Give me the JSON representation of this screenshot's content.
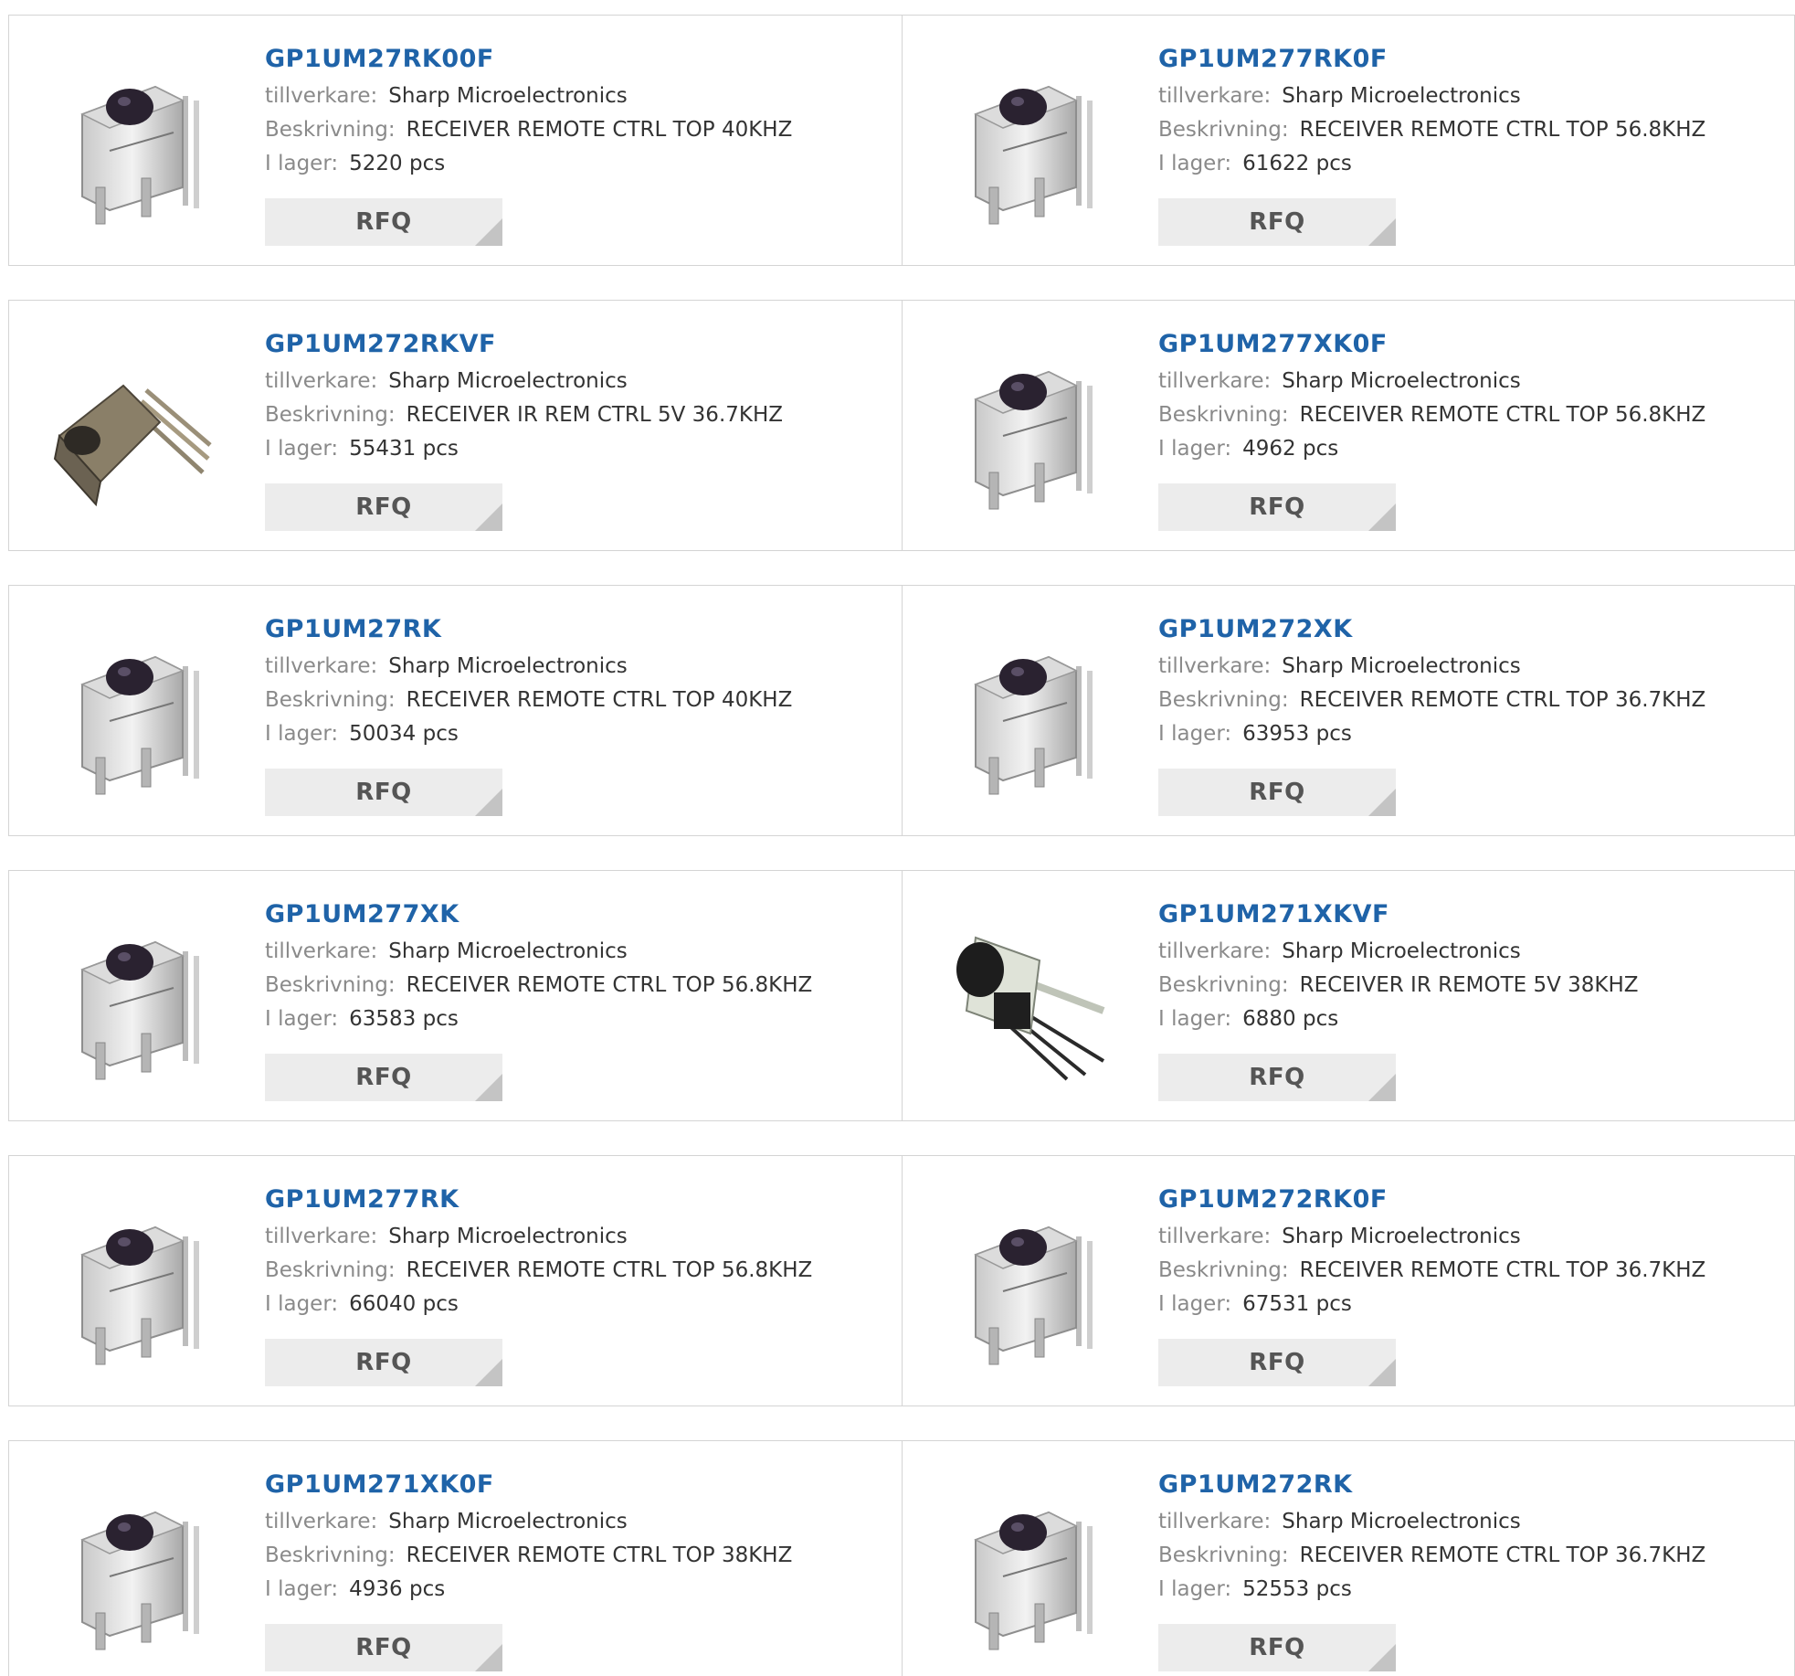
{
  "labels": {
    "manufacturer": "tillverkare:",
    "description": "Beskrivning:",
    "stock": "I lager:",
    "rfq": "RFQ"
  },
  "products": [
    {
      "part": "GP1UM27RK00F",
      "manufacturer": "Sharp Microelectronics",
      "description": "RECEIVER REMOTE CTRL TOP 40KHZ",
      "stock": "5220 pcs",
      "image": "ir-receiver-upright"
    },
    {
      "part": "GP1UM277RK0F",
      "manufacturer": "Sharp Microelectronics",
      "description": "RECEIVER REMOTE CTRL TOP 56.8KHZ",
      "stock": "61622 pcs",
      "image": "ir-receiver-upright"
    },
    {
      "part": "GP1UM272RKVF",
      "manufacturer": "Sharp Microelectronics",
      "description": "RECEIVER IR REM CTRL 5V 36.7KHZ",
      "stock": "55431 pcs",
      "image": "ir-receiver-angled"
    },
    {
      "part": "GP1UM277XK0F",
      "manufacturer": "Sharp Microelectronics",
      "description": "RECEIVER REMOTE CTRL TOP 56.8KHZ",
      "stock": "4962 pcs",
      "image": "ir-receiver-upright"
    },
    {
      "part": "GP1UM27RK",
      "manufacturer": "Sharp Microelectronics",
      "description": "RECEIVER REMOTE CTRL TOP 40KHZ",
      "stock": "50034 pcs",
      "image": "ir-receiver-upright"
    },
    {
      "part": "GP1UM272XK",
      "manufacturer": "Sharp Microelectronics",
      "description": "RECEIVER REMOTE CTRL TOP 36.7KHZ",
      "stock": "63953 pcs",
      "image": "ir-receiver-upright"
    },
    {
      "part": "GP1UM277XK",
      "manufacturer": "Sharp Microelectronics",
      "description": "RECEIVER REMOTE CTRL TOP 56.8KHZ",
      "stock": "63583 pcs",
      "image": "ir-receiver-upright"
    },
    {
      "part": "GP1UM271XKVF",
      "manufacturer": "Sharp Microelectronics",
      "description": "RECEIVER IR REMOTE 5V 38KHZ",
      "stock": "6880 pcs",
      "image": "ir-receiver-tilted"
    },
    {
      "part": "GP1UM277RK",
      "manufacturer": "Sharp Microelectronics",
      "description": "RECEIVER REMOTE CTRL TOP 56.8KHZ",
      "stock": "66040 pcs",
      "image": "ir-receiver-upright"
    },
    {
      "part": "GP1UM272RK0F",
      "manufacturer": "Sharp Microelectronics",
      "description": "RECEIVER REMOTE CTRL TOP 36.7KHZ",
      "stock": "67531 pcs",
      "image": "ir-receiver-upright"
    },
    {
      "part": "GP1UM271XK0F",
      "manufacturer": "Sharp Microelectronics",
      "description": "RECEIVER REMOTE CTRL TOP 38KHZ",
      "stock": "4936 pcs",
      "image": "ir-receiver-upright"
    },
    {
      "part": "GP1UM272RK",
      "manufacturer": "Sharp Microelectronics",
      "description": "RECEIVER REMOTE CTRL TOP 36.7KHZ",
      "stock": "52553 pcs",
      "image": "ir-receiver-upright"
    }
  ],
  "colors": {
    "link": "#1f63a8",
    "label": "#8a8a8a",
    "border": "#d4d4d4",
    "button_bg": "#ececec",
    "button_corner": "#c4c4c4"
  }
}
